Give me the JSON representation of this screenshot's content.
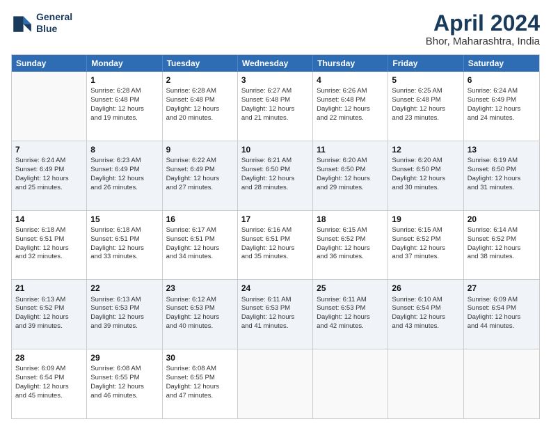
{
  "logo": {
    "line1": "General",
    "line2": "Blue"
  },
  "title": "April 2024",
  "subtitle": "Bhor, Maharashtra, India",
  "headers": [
    "Sunday",
    "Monday",
    "Tuesday",
    "Wednesday",
    "Thursday",
    "Friday",
    "Saturday"
  ],
  "rows": [
    [
      {
        "day": "",
        "info": ""
      },
      {
        "day": "1",
        "info": "Sunrise: 6:28 AM\nSunset: 6:48 PM\nDaylight: 12 hours\nand 19 minutes."
      },
      {
        "day": "2",
        "info": "Sunrise: 6:28 AM\nSunset: 6:48 PM\nDaylight: 12 hours\nand 20 minutes."
      },
      {
        "day": "3",
        "info": "Sunrise: 6:27 AM\nSunset: 6:48 PM\nDaylight: 12 hours\nand 21 minutes."
      },
      {
        "day": "4",
        "info": "Sunrise: 6:26 AM\nSunset: 6:48 PM\nDaylight: 12 hours\nand 22 minutes."
      },
      {
        "day": "5",
        "info": "Sunrise: 6:25 AM\nSunset: 6:48 PM\nDaylight: 12 hours\nand 23 minutes."
      },
      {
        "day": "6",
        "info": "Sunrise: 6:24 AM\nSunset: 6:49 PM\nDaylight: 12 hours\nand 24 minutes."
      }
    ],
    [
      {
        "day": "7",
        "info": "Sunrise: 6:24 AM\nSunset: 6:49 PM\nDaylight: 12 hours\nand 25 minutes."
      },
      {
        "day": "8",
        "info": "Sunrise: 6:23 AM\nSunset: 6:49 PM\nDaylight: 12 hours\nand 26 minutes."
      },
      {
        "day": "9",
        "info": "Sunrise: 6:22 AM\nSunset: 6:49 PM\nDaylight: 12 hours\nand 27 minutes."
      },
      {
        "day": "10",
        "info": "Sunrise: 6:21 AM\nSunset: 6:50 PM\nDaylight: 12 hours\nand 28 minutes."
      },
      {
        "day": "11",
        "info": "Sunrise: 6:20 AM\nSunset: 6:50 PM\nDaylight: 12 hours\nand 29 minutes."
      },
      {
        "day": "12",
        "info": "Sunrise: 6:20 AM\nSunset: 6:50 PM\nDaylight: 12 hours\nand 30 minutes."
      },
      {
        "day": "13",
        "info": "Sunrise: 6:19 AM\nSunset: 6:50 PM\nDaylight: 12 hours\nand 31 minutes."
      }
    ],
    [
      {
        "day": "14",
        "info": "Sunrise: 6:18 AM\nSunset: 6:51 PM\nDaylight: 12 hours\nand 32 minutes."
      },
      {
        "day": "15",
        "info": "Sunrise: 6:18 AM\nSunset: 6:51 PM\nDaylight: 12 hours\nand 33 minutes."
      },
      {
        "day": "16",
        "info": "Sunrise: 6:17 AM\nSunset: 6:51 PM\nDaylight: 12 hours\nand 34 minutes."
      },
      {
        "day": "17",
        "info": "Sunrise: 6:16 AM\nSunset: 6:51 PM\nDaylight: 12 hours\nand 35 minutes."
      },
      {
        "day": "18",
        "info": "Sunrise: 6:15 AM\nSunset: 6:52 PM\nDaylight: 12 hours\nand 36 minutes."
      },
      {
        "day": "19",
        "info": "Sunrise: 6:15 AM\nSunset: 6:52 PM\nDaylight: 12 hours\nand 37 minutes."
      },
      {
        "day": "20",
        "info": "Sunrise: 6:14 AM\nSunset: 6:52 PM\nDaylight: 12 hours\nand 38 minutes."
      }
    ],
    [
      {
        "day": "21",
        "info": "Sunrise: 6:13 AM\nSunset: 6:52 PM\nDaylight: 12 hours\nand 39 minutes."
      },
      {
        "day": "22",
        "info": "Sunrise: 6:13 AM\nSunset: 6:53 PM\nDaylight: 12 hours\nand 39 minutes."
      },
      {
        "day": "23",
        "info": "Sunrise: 6:12 AM\nSunset: 6:53 PM\nDaylight: 12 hours\nand 40 minutes."
      },
      {
        "day": "24",
        "info": "Sunrise: 6:11 AM\nSunset: 6:53 PM\nDaylight: 12 hours\nand 41 minutes."
      },
      {
        "day": "25",
        "info": "Sunrise: 6:11 AM\nSunset: 6:53 PM\nDaylight: 12 hours\nand 42 minutes."
      },
      {
        "day": "26",
        "info": "Sunrise: 6:10 AM\nSunset: 6:54 PM\nDaylight: 12 hours\nand 43 minutes."
      },
      {
        "day": "27",
        "info": "Sunrise: 6:09 AM\nSunset: 6:54 PM\nDaylight: 12 hours\nand 44 minutes."
      }
    ],
    [
      {
        "day": "28",
        "info": "Sunrise: 6:09 AM\nSunset: 6:54 PM\nDaylight: 12 hours\nand 45 minutes."
      },
      {
        "day": "29",
        "info": "Sunrise: 6:08 AM\nSunset: 6:55 PM\nDaylight: 12 hours\nand 46 minutes."
      },
      {
        "day": "30",
        "info": "Sunrise: 6:08 AM\nSunset: 6:55 PM\nDaylight: 12 hours\nand 47 minutes."
      },
      {
        "day": "",
        "info": ""
      },
      {
        "day": "",
        "info": ""
      },
      {
        "day": "",
        "info": ""
      },
      {
        "day": "",
        "info": ""
      }
    ]
  ]
}
